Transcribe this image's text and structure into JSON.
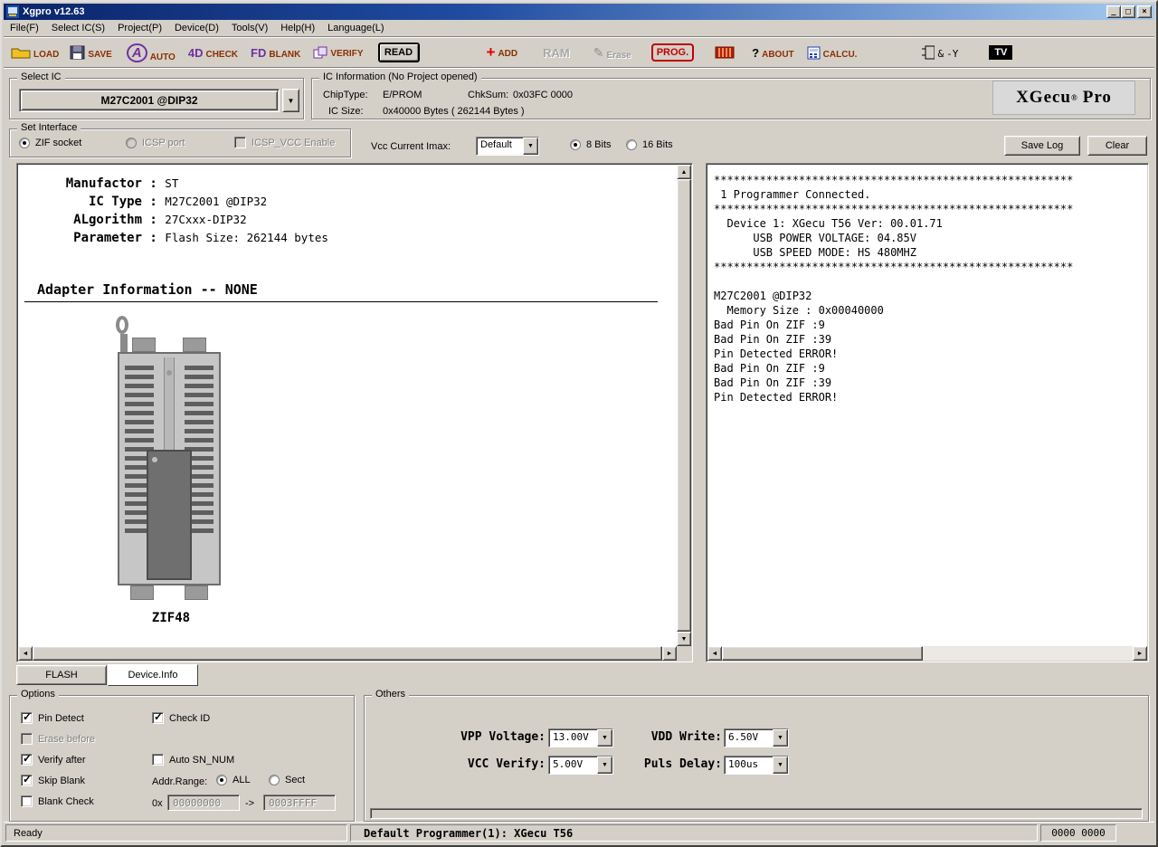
{
  "window": {
    "title": "Xgpro v12.63"
  },
  "menu": {
    "items": [
      "File(F)",
      "Select IC(S)",
      "Project(P)",
      "Device(D)",
      "Tools(V)",
      "Help(H)",
      "Language(L)"
    ]
  },
  "toolbar": {
    "load": "LOAD",
    "save": "SAVE",
    "auto": "AUTO",
    "check": "CHECK",
    "blank": "BLANK",
    "verify": "VERIFY",
    "read": "READ",
    "add": "ADD",
    "ram": "RAM",
    "erase": "Erase",
    "prog": "PROG.",
    "about": "ABOUT",
    "calcu": "CALCU.",
    "tv": "TV"
  },
  "icons": {
    "auto_glyph": "A",
    "check_glyph": "4D",
    "blank_glyph": "FD",
    "add_glyph": "+",
    "erase_glyph": "✎",
    "about_glyph": "?",
    "logic_glyph": "&",
    "logic_out": "-Y"
  },
  "select_ic": {
    "group_label": "Select IC",
    "value": "M27C2001 @DIP32"
  },
  "ic_info": {
    "group_label": "IC Information (No Project opened)",
    "chip_type_label": "ChipType:",
    "chip_type": "E/PROM",
    "chksum_label": "ChkSum:",
    "chksum": "0x03FC 0000",
    "ic_size_label": "IC Size:",
    "ic_size": "0x40000 Bytes ( 262144 Bytes )"
  },
  "brand": {
    "logo": "XGecu",
    "reg": "®",
    "pro": "Pro"
  },
  "interface": {
    "group_label": "Set Interface",
    "zif": "ZIF socket",
    "icsp": "ICSP port",
    "icsp_vcc": "ICSP_VCC Enable",
    "vcc_label": "Vcc Current Imax:",
    "vcc_value": "Default",
    "bits8": "8 Bits",
    "bits16": "16 Bits",
    "save_log": "Save Log",
    "clear": "Clear"
  },
  "device_info": {
    "colon": " : ",
    "rows": [
      {
        "label": "Manufactor",
        "value": "ST"
      },
      {
        "label": "IC Type",
        "value": "M27C2001 @DIP32"
      },
      {
        "label": "ALgorithm",
        "value": "27Cxxx-DIP32"
      },
      {
        "label": "Parameter",
        "value": "Flash Size: 262144 bytes"
      }
    ],
    "adapter": "Adapter Information -- NONE",
    "socket_label": "ZIF48"
  },
  "log": {
    "text": "*******************************************************\n 1 Programmer Connected.\n*******************************************************\n  Device 1: XGecu T56 Ver: 00.01.71\n      USB POWER VOLTAGE: 04.85V\n      USB SPEED MODE: HS 480MHZ\n*******************************************************\n\nM27C2001 @DIP32\n  Memory Size : 0x00040000\nBad Pin On ZIF :9\nBad Pin On ZIF :39\nPin Detected ERROR!\nBad Pin On ZIF :9\nBad Pin On ZIF :39\nPin Detected ERROR!"
  },
  "tabs": {
    "flash": "FLASH",
    "device_info": "Device.Info"
  },
  "options": {
    "group_label": "Options",
    "pin_detect": "Pin Detect",
    "check_id": "Check ID",
    "erase_before": "Erase before",
    "verify_after": "Verify after",
    "auto_sn": "Auto SN_NUM",
    "skip_blank": "Skip Blank",
    "addr_range": "Addr.Range:",
    "all": "ALL",
    "sect": "Sect",
    "blank_check": "Blank Check",
    "hex_prefix": "0x",
    "addr_start": "00000000",
    "arrow": "->",
    "addr_end": "0003FFFF"
  },
  "others": {
    "group_label": "Others",
    "vpp_label": "VPP Voltage:",
    "vpp": "13.00V",
    "vdd_label": "VDD Write:",
    "vdd": "6.50V",
    "vcc_label": "VCC Verify:",
    "vcc": "5.00V",
    "puls_label": "Puls Delay:",
    "puls": "100us"
  },
  "status": {
    "ready": "Ready",
    "programmer": "Default Programmer(1): XGecu T56",
    "counter": "0000 0000"
  }
}
